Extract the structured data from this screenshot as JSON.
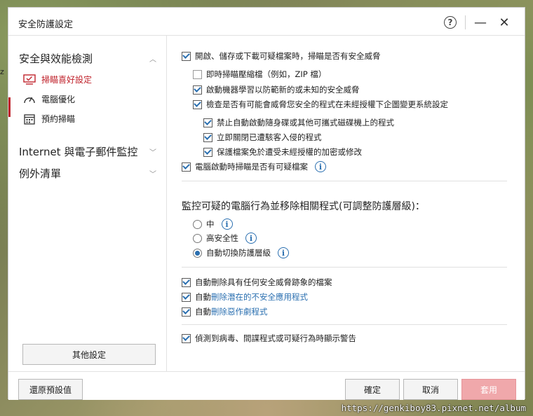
{
  "window": {
    "title": "安全防護設定"
  },
  "sidebar": {
    "section1": "安全與效能檢測",
    "items": [
      {
        "label": "掃瞄喜好設定",
        "icon": "scan-monitor-icon",
        "active": true
      },
      {
        "label": "電腦優化",
        "icon": "speedometer-icon",
        "active": false
      },
      {
        "label": "預約掃瞄",
        "icon": "calendar-icon",
        "active": false
      }
    ],
    "section2": "Internet 與電子郵件監控",
    "section3": "例外清單",
    "other_button": "其他設定"
  },
  "content": {
    "opt_open_scan": "開啟、儲存或下載可疑檔案時，掃瞄是否有安全威脅",
    "opt_realtime_zip": "即時掃瞄壓縮檔（例如，ZIP 檔）",
    "opt_ml": "啟動機器學習以防範新的或未知的安全威脅",
    "opt_check_unauth": "檢查是否有可能會威脅您安全的程式在未經授權下企圖變更系統設定",
    "opt_block_autorun": "禁止自動啟動隨身碟或其他可攜式磁碟機上的程式",
    "opt_close_infected": "立即關閉已遭駭客入侵的程式",
    "opt_protect_files": "保護檔案免於遭受未經授權的加密或修改",
    "opt_boot_scan": "電腦啟動時掃瞄是否有可疑檔案",
    "behavior_title": "監控可疑的電腦行為並移除相關程式(可調整防護層級)：",
    "radio_mid": "中",
    "radio_high": "高安全性",
    "radio_auto": "自動切換防護層級",
    "opt_del_threat_files": "自動刪除具有任何安全威脅跡象的檔案",
    "opt_del_unsafe_prefix": "自動",
    "opt_del_unsafe_link": "刪除潛在的不安全應用程式",
    "opt_del_joke_prefix": "自動",
    "opt_del_joke_link": "刪除惡作劇程式",
    "opt_show_warning": "偵測到病毒、間諜程式或可疑行為時顯示警告"
  },
  "footer": {
    "restore": "還原預設值",
    "ok": "確定",
    "cancel": "取消",
    "apply": "套用"
  },
  "watermark": "https://genkiboy83.pixnet.net/album",
  "colors": {
    "accent": "#c0232c",
    "link": "#2a6fb0",
    "apply_disabled": "#f0a8ab"
  }
}
